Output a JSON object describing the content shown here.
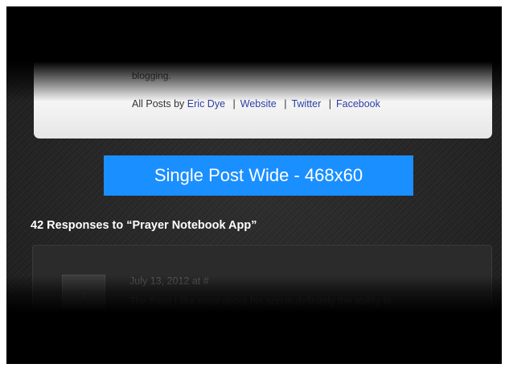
{
  "bio": {
    "text_fragment": "blogging.",
    "posts_by_prefix": "All Posts by",
    "author_name": "Eric Dye",
    "links": {
      "website": "Website",
      "twitter": "Twitter",
      "facebook": "Facebook"
    },
    "separator": "|"
  },
  "ad": {
    "label": "Single Post Wide - 468x60",
    "color": "#1a8fff"
  },
  "responses": {
    "heading": "42 Responses to “Prayer Notebook App”"
  },
  "comment": {
    "avatar_placeholder": "?",
    "date": "July 13, 2012 at #",
    "text": "The thing I like most about his app is definitely the ability to"
  },
  "colors": {
    "background": "#232323",
    "link": "#2b3fa3"
  }
}
